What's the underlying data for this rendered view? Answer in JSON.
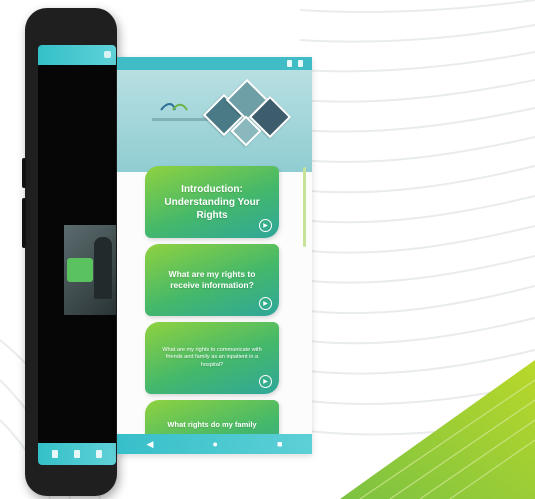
{
  "colors": {
    "teal": "#3fbcc6",
    "card_green": "#8fd23f",
    "card_teal": "#2fa79a",
    "accent_green": "#a6cf2e"
  },
  "cards": [
    {
      "title": "Introduction: Understanding Your Rights",
      "icon": "play-circle-icon"
    },
    {
      "title": "What are my rights to receive information?",
      "icon": "play-circle-icon"
    },
    {
      "title": "What are my rights to communicate with friends and family as an inpatient in a hospital?",
      "icon": "play-circle-icon"
    },
    {
      "title": "What rights do my family",
      "icon": "play-circle-icon"
    }
  ],
  "navbar": {
    "back": "◀",
    "home": "●",
    "recents": "■"
  }
}
